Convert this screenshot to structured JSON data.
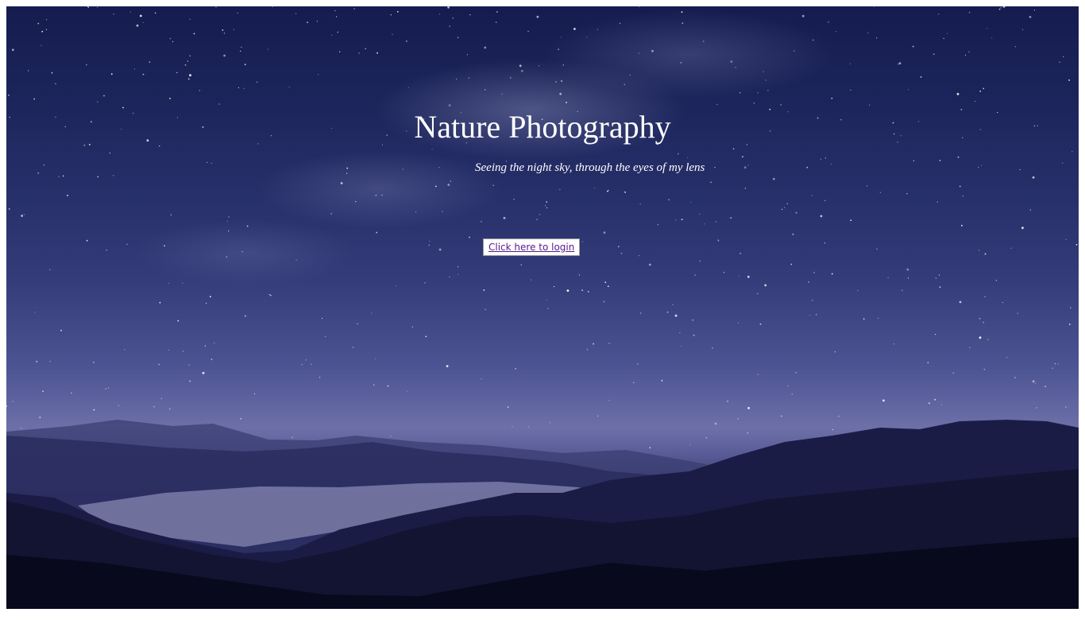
{
  "page": {
    "title": "Nature Photography",
    "subtitle": "Seeing the night sky, through the eyes of my lens",
    "login_link": "Click here to login"
  },
  "colors": {
    "sky_top": "#151c4f",
    "sky_horizon": "#6d70a8",
    "mountains": "#07081a",
    "text": "#ffffff",
    "link_visited": "#551a8b"
  },
  "background": {
    "description_icon": "night-sky-mountains-image"
  }
}
